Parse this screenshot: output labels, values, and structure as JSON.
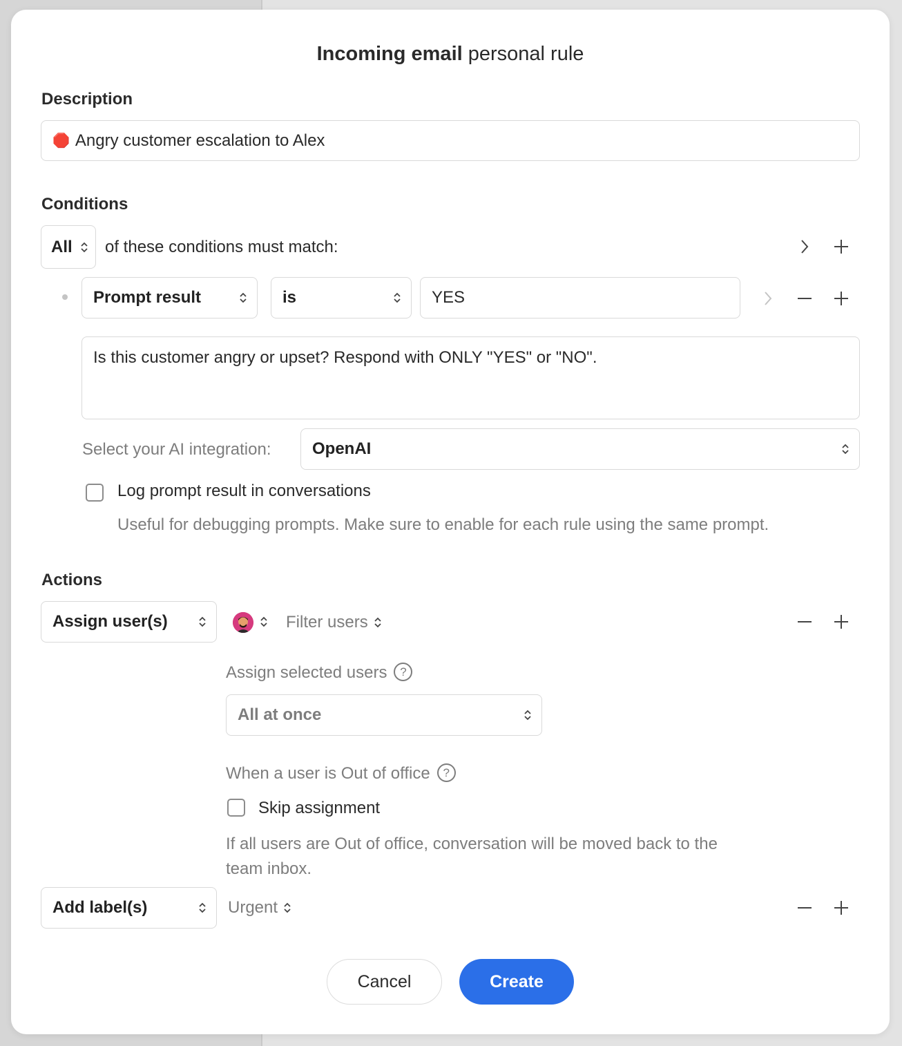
{
  "modal": {
    "title_bold": "Incoming email",
    "title_rest": " personal rule"
  },
  "description": {
    "label": "Description",
    "value": "Angry customer escalation to Alex",
    "emoji": "🛑"
  },
  "conditions": {
    "label": "Conditions",
    "match_mode": "All",
    "match_text": "of these conditions must match:",
    "condition": {
      "field": "Prompt result",
      "operator": "is",
      "value": "YES",
      "prompt": "Is this customer angry or upset? Respond with ONLY \"YES\" or \"NO\".",
      "integration_label": "Select your AI integration:",
      "integration_value": "OpenAI",
      "log_label": "Log prompt result in conversations",
      "log_help": "Useful for debugging prompts. Make sure to enable for each rule using the same prompt."
    }
  },
  "actions": {
    "label": "Actions",
    "assign": {
      "action": "Assign user(s)",
      "filter_placeholder": "Filter users",
      "assign_mode_label": "Assign selected users",
      "assign_mode_value": "All at once",
      "ooo_label": "When a user is Out of office",
      "skip_label": "Skip assignment",
      "ooo_help": "If all users are Out of office, conversation will be moved back to the team inbox."
    },
    "label_action": {
      "action": "Add label(s)",
      "value": "Urgent"
    }
  },
  "footer": {
    "cancel": "Cancel",
    "create": "Create"
  },
  "colors": {
    "primary": "#2b6fe8",
    "muted_text": "#7d7d7d"
  }
}
